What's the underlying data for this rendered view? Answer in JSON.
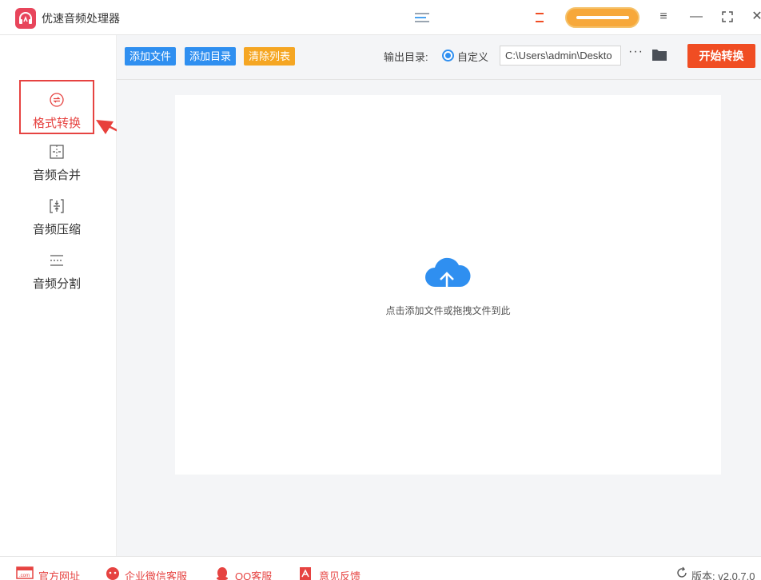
{
  "app": {
    "title": "优速音频处理器"
  },
  "sidebar": {
    "items": [
      {
        "label": "格式转换",
        "icon": "convert-icon",
        "active": true
      },
      {
        "label": "音频合并",
        "icon": "merge-icon"
      },
      {
        "label": "音频压缩",
        "icon": "compress-icon"
      },
      {
        "label": "音频分割",
        "icon": "split-icon"
      }
    ]
  },
  "toolbar": {
    "add_file": "添加文件",
    "add_folder": "添加目录",
    "clear_list": "清除列表",
    "output_label": "输出目录:",
    "radio_label": "自定义",
    "output_path": "C:\\Users\\admin\\Deskto",
    "more": "···",
    "start": "开始转换"
  },
  "main": {
    "drop_hint": "点击添加文件或拖拽文件到此"
  },
  "footer": {
    "website": "官方网址",
    "wechat": "企业微信客服",
    "qq": "QQ客服",
    "feedback": "意见反馈",
    "version": "版本: v2.0.7.0"
  },
  "colors": {
    "accent_red": "#e64341",
    "button_blue": "#2f8ff0",
    "button_orange": "#f5a623",
    "start_red": "#f04d23"
  }
}
